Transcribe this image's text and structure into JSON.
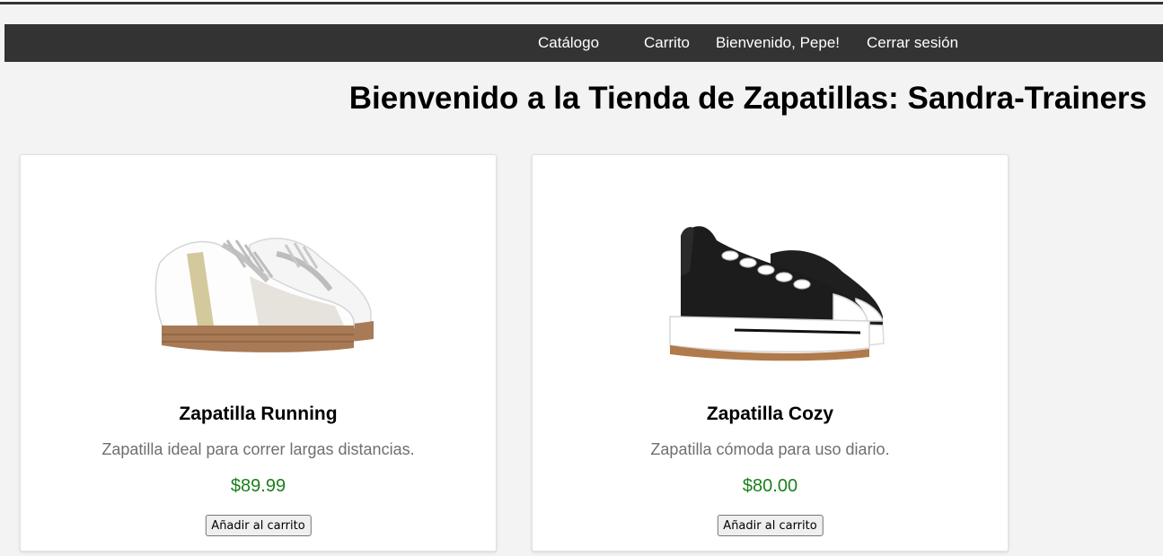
{
  "nav": {
    "catalogo": "Catálogo",
    "carrito": "Carrito",
    "welcome": "Bienvenido, Pepe!",
    "logout": "Cerrar sesión"
  },
  "page": {
    "title": "Bienvenido a la Tienda de Zapatillas: Sandra-Trainers"
  },
  "products": [
    {
      "name": "Zapatilla Running",
      "description": "Zapatilla ideal para correr largas distancias.",
      "price": "$89.99",
      "button": "Añadir al carrito",
      "image": "white-sneaker-brown-sole"
    },
    {
      "name": "Zapatilla Cozy",
      "description": "Zapatilla cómoda para uso diario.",
      "price": "$80.00",
      "button": "Añadir al carrito",
      "image": "black-canvas-sneaker-platform-sole"
    }
  ],
  "colors": {
    "navbar": "#333333",
    "background": "#f3f3f3",
    "price": "#1b7f1b",
    "description": "#6f6f6f"
  }
}
